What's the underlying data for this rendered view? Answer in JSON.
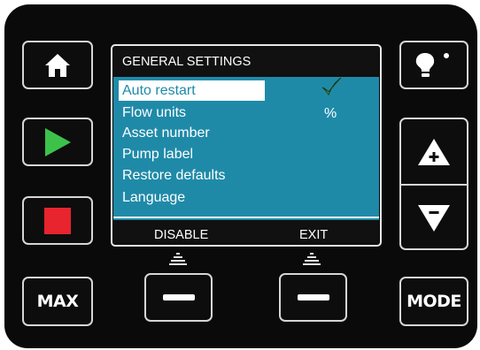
{
  "screen": {
    "title": "GENERAL SETTINGS",
    "menu_items": [
      {
        "label": "Auto restart",
        "value": "✓",
        "selected": true
      },
      {
        "label": "Flow units",
        "value": "%",
        "selected": false
      },
      {
        "label": "Asset number",
        "value": "",
        "selected": false
      },
      {
        "label": "Pump label",
        "value": "",
        "selected": false
      },
      {
        "label": "Restore defaults",
        "value": "",
        "selected": false
      },
      {
        "label": "Language",
        "value": "",
        "selected": false
      }
    ],
    "softkeys": {
      "left": "DISABLE",
      "right": "EXIT"
    }
  },
  "buttons": {
    "home": "home-icon",
    "start": "play-icon",
    "stop": "stop-icon",
    "max_label": "MAX",
    "info": "lightbulb-icon",
    "up": "plus-up-arrow-icon",
    "down": "minus-down-arrow-icon",
    "mode_label": "MODE"
  },
  "colors": {
    "screen_bg": "#1f8aa8",
    "title_bar": "#111111",
    "play": "#3cc24a",
    "stop": "#e8242e",
    "check": "#5fcf4a"
  }
}
